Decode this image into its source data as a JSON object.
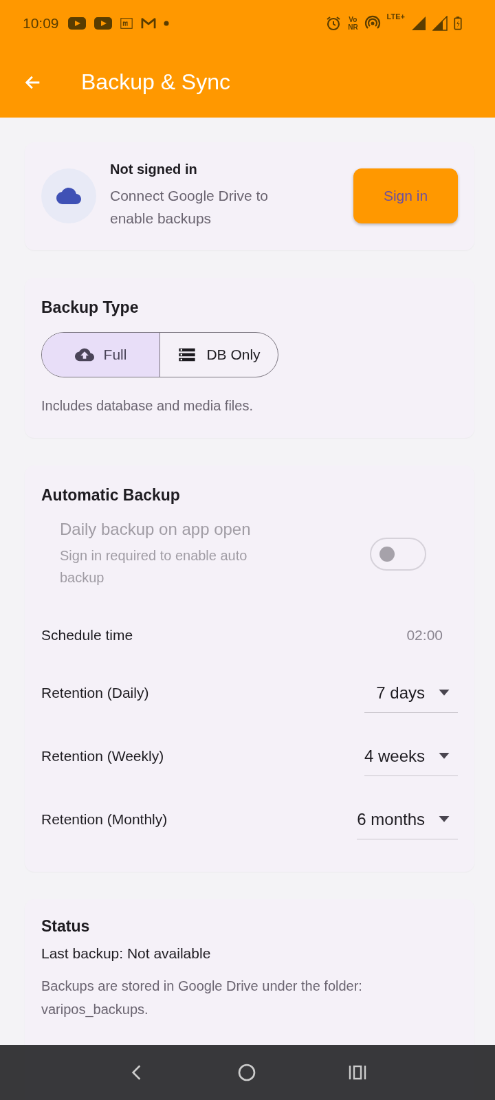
{
  "status_bar": {
    "time": "10:09",
    "vonr_top": "Vo",
    "vonr_bottom": "NR",
    "network": "LTE+"
  },
  "app_bar": {
    "title": "Backup & Sync"
  },
  "account_card": {
    "title": "Not signed in",
    "subtitle": "Connect Google Drive to enable backups",
    "button": "Sign in"
  },
  "backup_type": {
    "title": "Backup Type",
    "options": [
      {
        "label": "Full",
        "kind": "cloud",
        "selected": true
      },
      {
        "label": "DB Only",
        "kind": "storage",
        "selected": false
      }
    ],
    "description": "Includes database and media files."
  },
  "automatic_backup": {
    "title": "Automatic Backup",
    "toggle": {
      "label": "Daily backup on app open",
      "sublabel": "Sign in required to enable auto backup",
      "on": false,
      "disabled": true
    },
    "schedule": {
      "label": "Schedule time",
      "value": "02:00"
    },
    "retentions": [
      {
        "label": "Retention (Daily)",
        "value": "7 days"
      },
      {
        "label": "Retention (Weekly)",
        "value": "4 weeks"
      },
      {
        "label": "Retention (Monthly)",
        "value": "6 months"
      }
    ]
  },
  "status": {
    "title": "Status",
    "last_backup": "Last backup: Not available",
    "paragraphs": [
      "Backups are stored in Google Drive under the folder: varipos_backups."
    ]
  }
}
